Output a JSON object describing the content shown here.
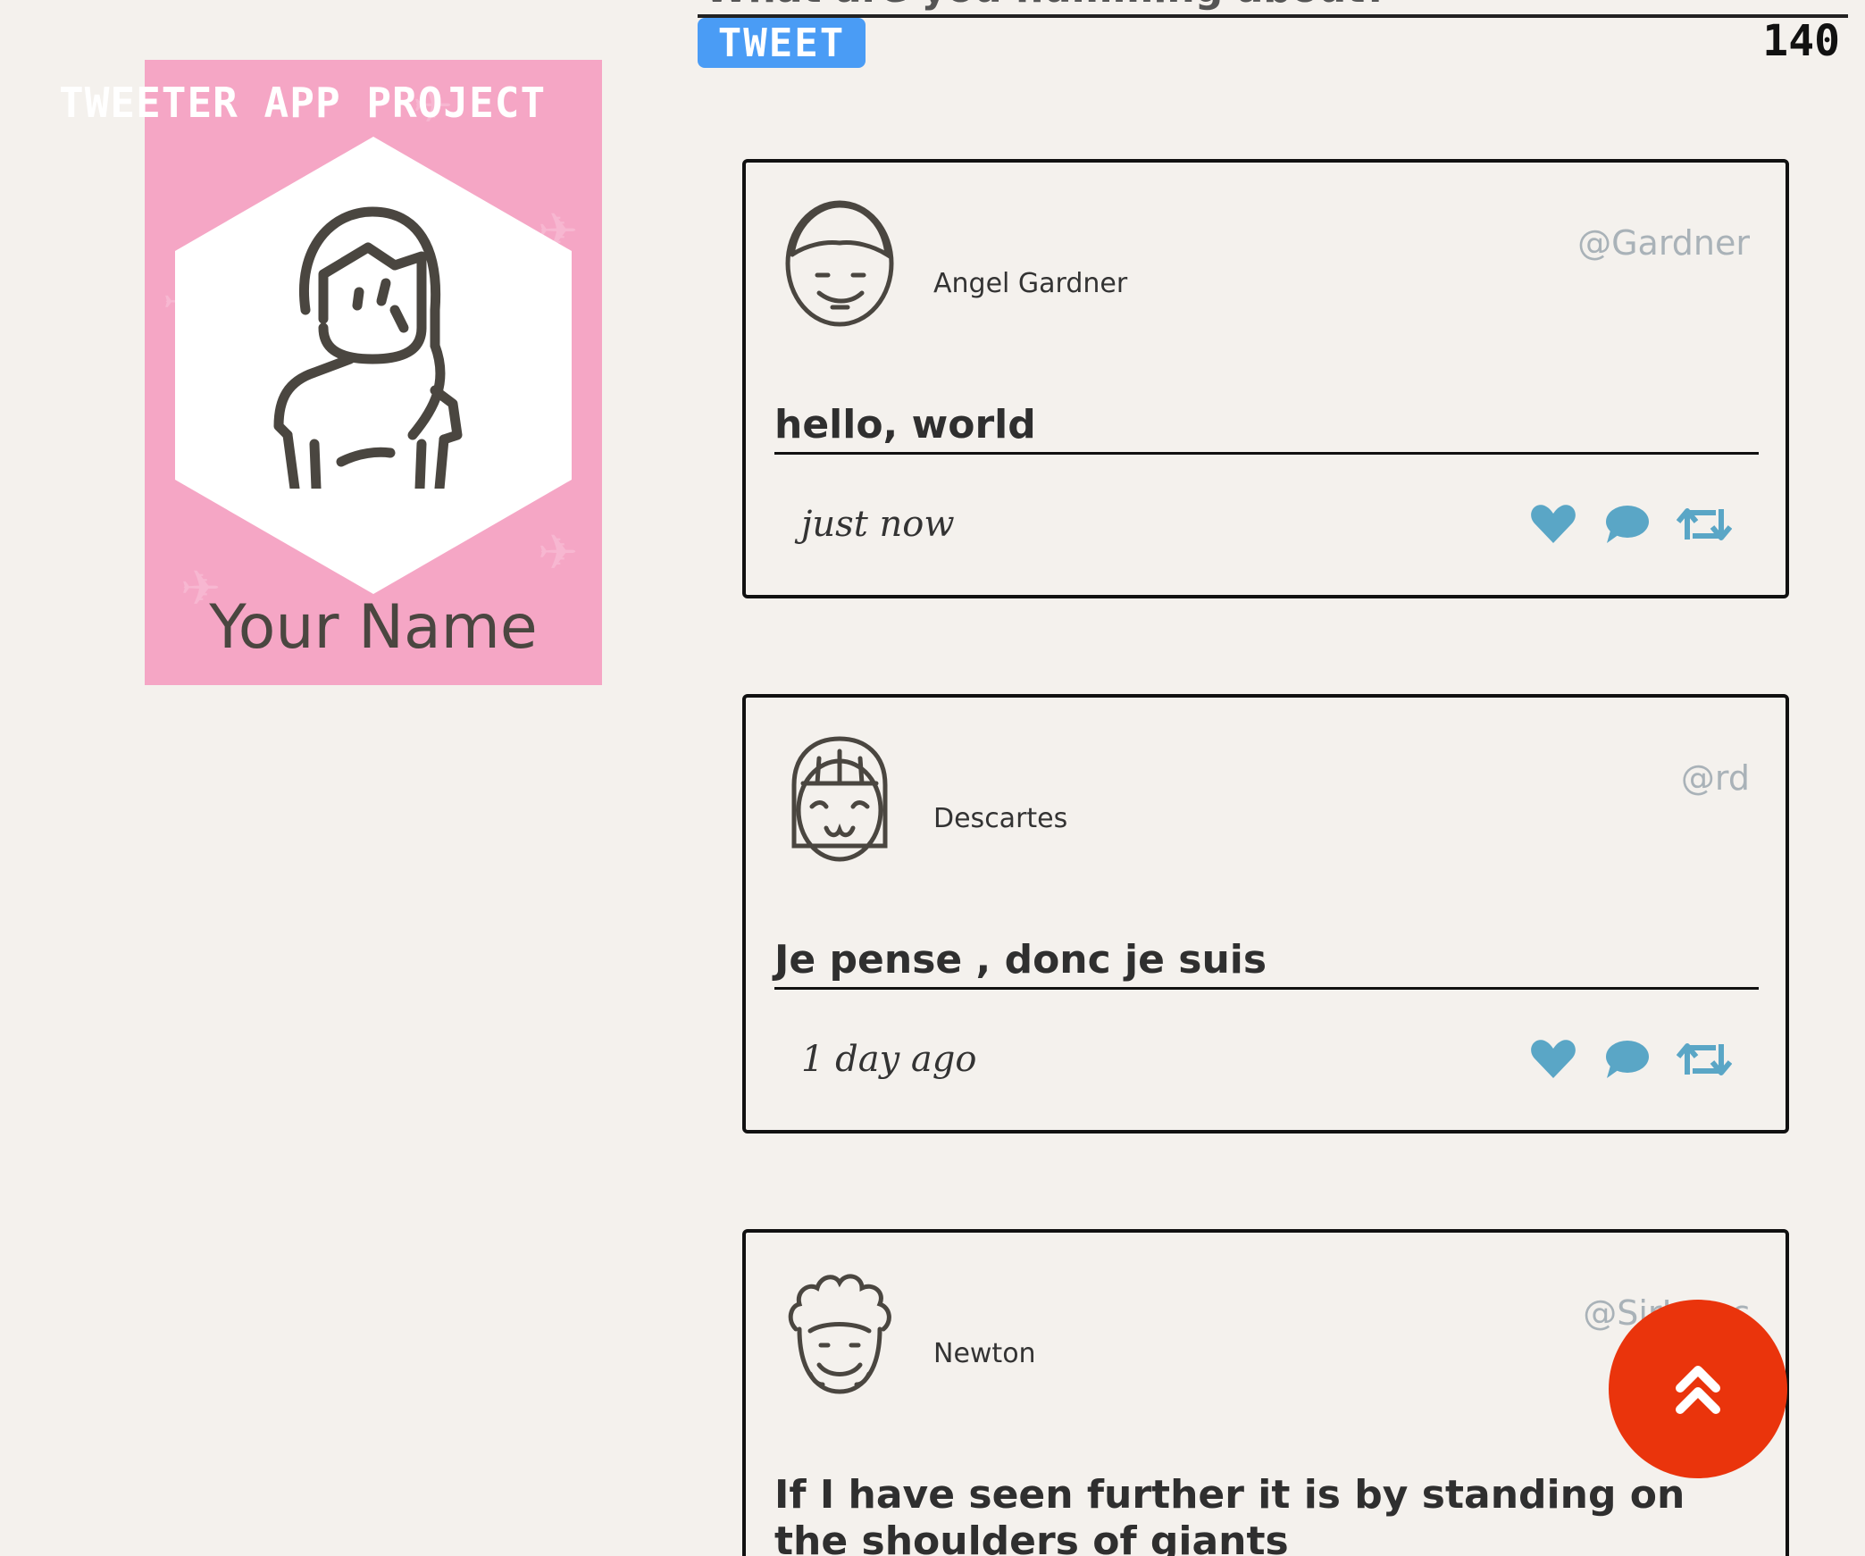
{
  "compose": {
    "placeholder": "What are you humming about?",
    "tweet_label": "TWEET",
    "char_count": "140"
  },
  "app": {
    "title": "TWEETER APP PROJECT"
  },
  "profile": {
    "name": "Your Name"
  },
  "tweets": [
    {
      "author": "Angel Gardner",
      "handle": "@Gardner",
      "text": "hello, world",
      "time": "just now",
      "avatar_icon": "man-avatar-icon"
    },
    {
      "author": "Descartes",
      "handle": "@rd",
      "text": "Je pense , donc je suis",
      "time": "1 day ago",
      "avatar_icon": "woman-avatar-icon"
    },
    {
      "author": "Newton",
      "handle": "@SirIsaac",
      "text": "If I have seen further it is by standing on the shoulders of giants",
      "time": "",
      "avatar_icon": "curly-hair-avatar-icon"
    }
  ],
  "colors": {
    "background": "#f4f1ed",
    "tweet_button": "#4a9cf5",
    "profile_card": "#f5a6c5",
    "action_icons": "#5aa6c6",
    "scroll_top": "#ea340c"
  }
}
